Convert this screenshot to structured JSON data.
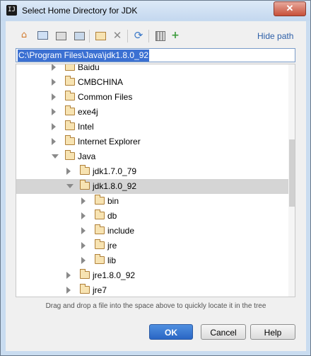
{
  "window": {
    "title": "Select Home Directory for JDK",
    "app_icon": "IJ",
    "close_glyph": "✕"
  },
  "toolbar": {
    "icons": [
      "home-icon",
      "desktop-icon",
      "project-folder-icon",
      "module-folder-icon",
      "new-folder-icon",
      "delete-icon",
      "refresh-icon",
      "show-hidden-icon",
      "new-item-icon"
    ],
    "hide_path_label": "Hide path"
  },
  "path": {
    "value": "C:\\Program Files\\Java\\jdk1.8.0_92"
  },
  "tree": {
    "rows": [
      {
        "label": "Baidu",
        "level": 0,
        "expanded": false,
        "selected": false
      },
      {
        "label": "CMBCHINA",
        "level": 0,
        "expanded": false,
        "selected": false
      },
      {
        "label": "Common Files",
        "level": 0,
        "expanded": false,
        "selected": false
      },
      {
        "label": "exe4j",
        "level": 0,
        "expanded": false,
        "selected": false
      },
      {
        "label": "Intel",
        "level": 0,
        "expanded": false,
        "selected": false
      },
      {
        "label": "Internet Explorer",
        "level": 0,
        "expanded": false,
        "selected": false
      },
      {
        "label": "Java",
        "level": 0,
        "expanded": true,
        "selected": false
      },
      {
        "label": "jdk1.7.0_79",
        "level": 1,
        "expanded": false,
        "selected": false
      },
      {
        "label": "jdk1.8.0_92",
        "level": 1,
        "expanded": true,
        "selected": true
      },
      {
        "label": "bin",
        "level": 2,
        "expanded": false,
        "selected": false
      },
      {
        "label": "db",
        "level": 2,
        "expanded": false,
        "selected": false
      },
      {
        "label": "include",
        "level": 2,
        "expanded": false,
        "selected": false
      },
      {
        "label": "jre",
        "level": 2,
        "expanded": false,
        "selected": false
      },
      {
        "label": "lib",
        "level": 2,
        "expanded": false,
        "selected": false
      },
      {
        "label": "jre1.8.0_92",
        "level": 1,
        "expanded": false,
        "selected": false
      },
      {
        "label": "jre7",
        "level": 1,
        "expanded": false,
        "selected": false
      }
    ]
  },
  "hint": "Drag and drop a file into the space above to quickly locate it in the tree",
  "buttons": {
    "ok": "OK",
    "cancel": "Cancel",
    "help": "Help"
  }
}
